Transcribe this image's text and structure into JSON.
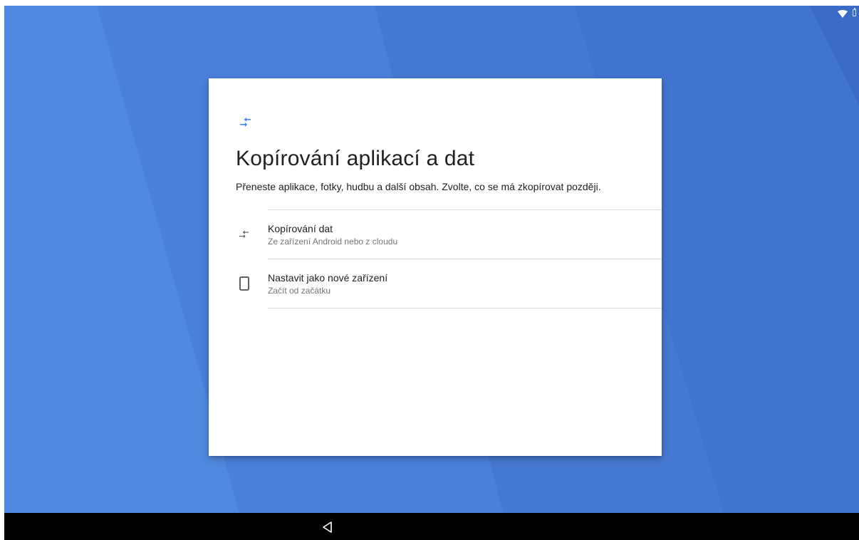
{
  "colors": {
    "wallpaper": "#4a7fd8",
    "accent": "#4285f4",
    "card": "#ffffff",
    "nav_bar": "#000000"
  },
  "header": {
    "icon": "swap-arrows-icon",
    "title": "Kopírování aplikací a dat",
    "subtitle": "Přeneste aplikace, fotky, hudbu a další obsah. Zvolte, co se má zkopírovat později."
  },
  "options": [
    {
      "icon": "swap-arrows-icon",
      "title": "Kopírování dat",
      "description": "Ze zařízení Android nebo z cloudu"
    },
    {
      "icon": "tablet-icon",
      "title": "Nastavit jako nové zařízení",
      "description": "Začít od začátku"
    }
  ],
  "status_bar": {
    "icons": [
      "wifi-icon",
      "battery-icon"
    ]
  },
  "nav_bar": {
    "icons": [
      "back-icon"
    ]
  }
}
